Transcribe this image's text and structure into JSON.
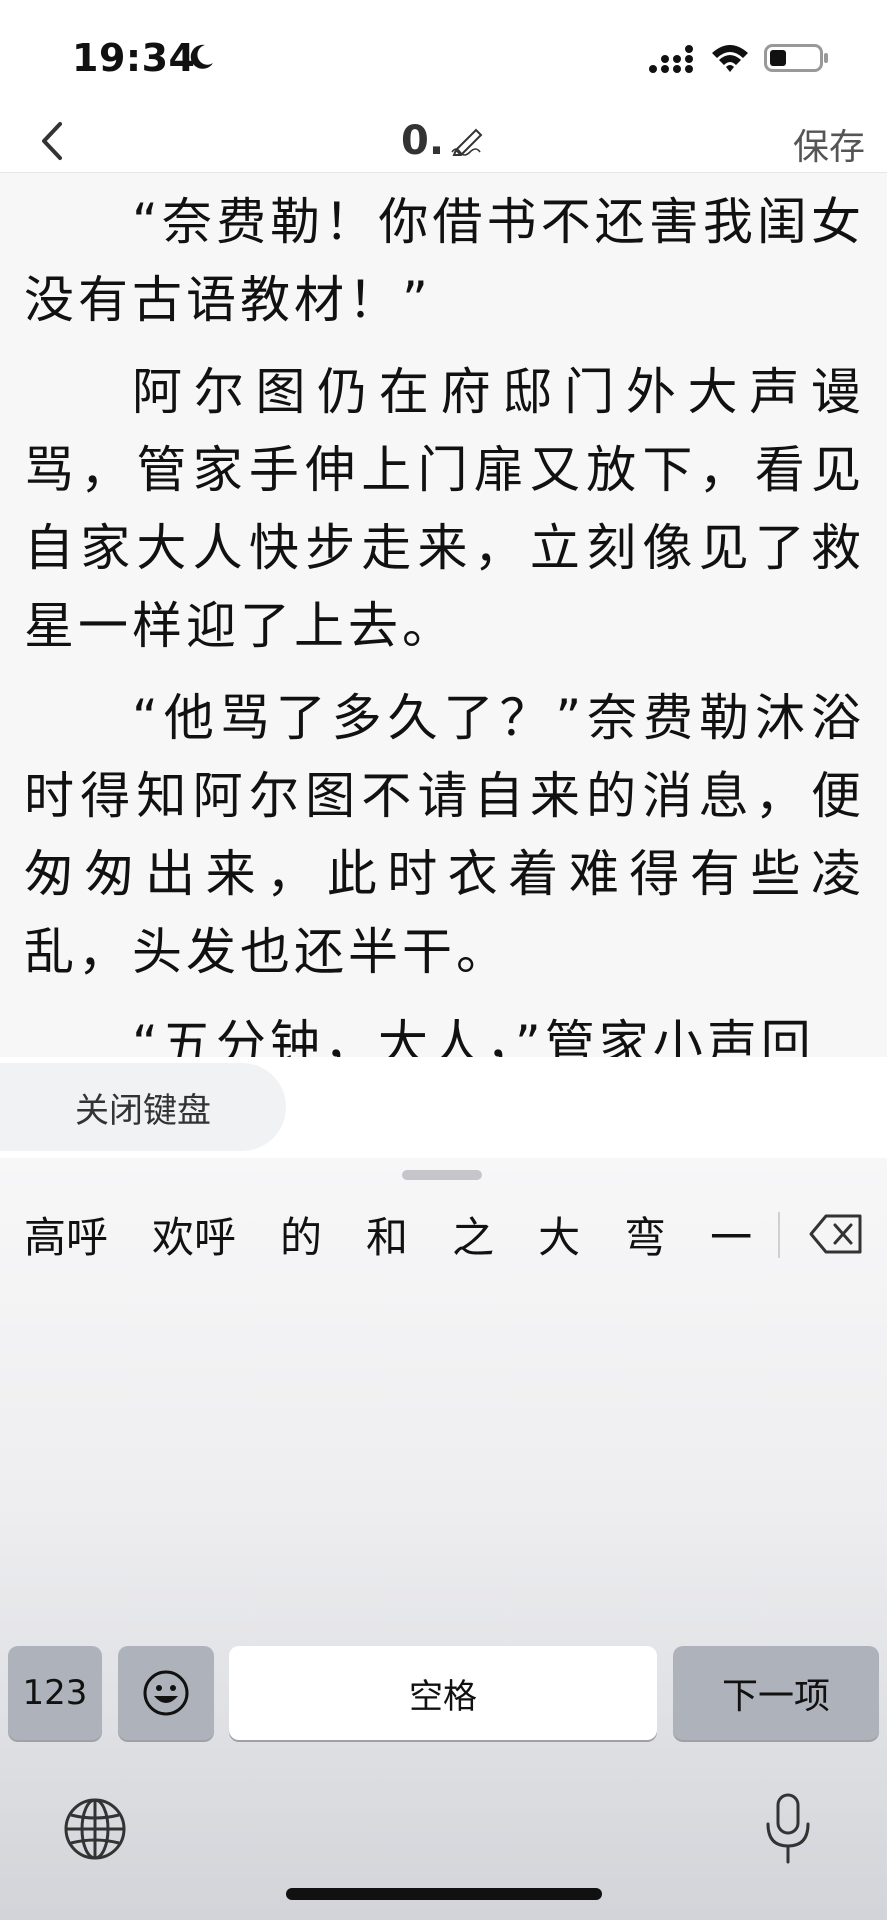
{
  "status_bar": {
    "time": "19:34",
    "icons": [
      "moon-icon",
      "signal-icon",
      "wifi-icon",
      "battery-icon"
    ]
  },
  "nav": {
    "title": "0.",
    "title_icon": "pen-icon",
    "back_icon": "chevron-left-icon",
    "save_label": "保存"
  },
  "editor": {
    "paragraphs": [
      "“奈费勒！你借书不还害我闺女没有古语教材！”",
      "阿尔图仍在府邸门外大声谩骂，管家手伸上门扉又放下，看见自家大人快步走来，立刻像见了救星一样迎了上去。",
      "“他骂了多久了？”奈费勒沐浴时得知阿尔图不请自来的消息，便匆匆出来，此时衣着难得有些凌乱，头发也还半干。",
      "“五分钟，大人，”管家小声回"
    ]
  },
  "keyboard_toolbar": {
    "close_label": "关闭键盘"
  },
  "keyboard": {
    "candidates": [
      "高呼",
      "欢呼",
      "的",
      "和",
      "之",
      "大",
      "弯",
      "一"
    ],
    "keys": {
      "numbers": "123",
      "space": "空格",
      "next": "下一项"
    },
    "icons": [
      "delete-icon",
      "emoji-icon",
      "globe-icon",
      "microphone-icon"
    ]
  }
}
